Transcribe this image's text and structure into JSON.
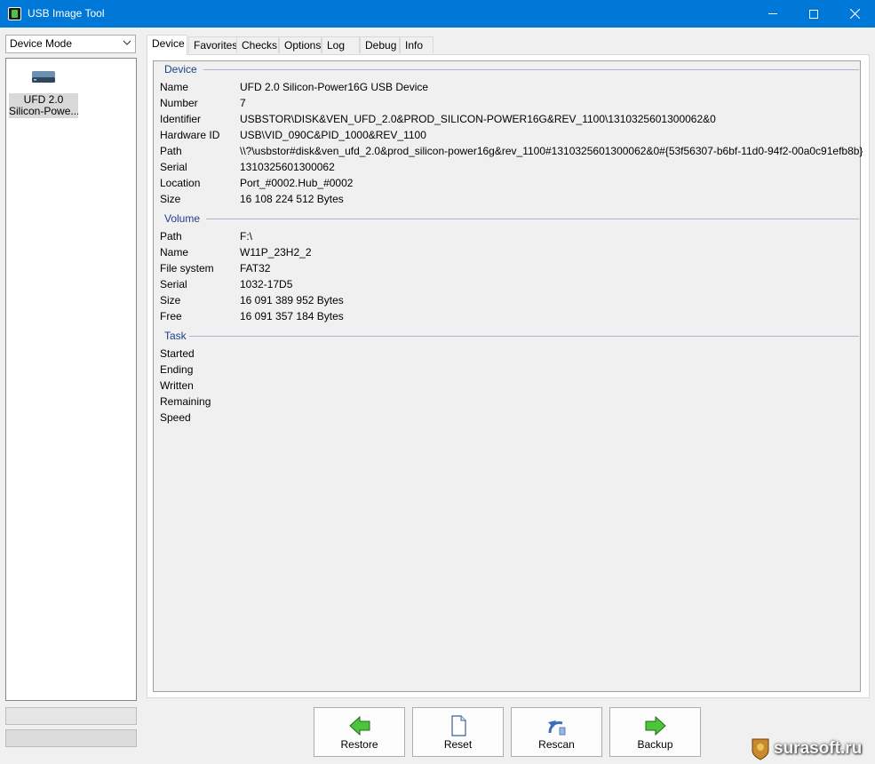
{
  "window": {
    "title": "USB Image Tool"
  },
  "colors": {
    "titlebar": "#0078d7",
    "section_header": "#1e3f8a"
  },
  "mode_select": {
    "value": "Device Mode"
  },
  "devices": [
    {
      "line1": "UFD 2.0",
      "line2": "Silicon-Powe..."
    }
  ],
  "tabs": [
    "Device",
    "Favorites",
    "Checks",
    "Options",
    "Log",
    "Debug",
    "Info"
  ],
  "sections": {
    "device": {
      "title": "Device",
      "rows": [
        {
          "label": "Name",
          "value": "UFD 2.0 Silicon-Power16G USB Device"
        },
        {
          "label": "Number",
          "value": "7"
        },
        {
          "label": "Identifier",
          "value": "USBSTOR\\DISK&VEN_UFD_2.0&PROD_SILICON-POWER16G&REV_1100\\1310325601300062&0"
        },
        {
          "label": "Hardware ID",
          "value": "USB\\VID_090C&PID_1000&REV_1100"
        },
        {
          "label": "Path",
          "value": "\\\\?\\usbstor#disk&ven_ufd_2.0&prod_silicon-power16g&rev_1100#1310325601300062&0#{53f56307-b6bf-11d0-94f2-00a0c91efb8b}"
        },
        {
          "label": "Serial",
          "value": "1310325601300062"
        },
        {
          "label": "Location",
          "value": "Port_#0002.Hub_#0002"
        },
        {
          "label": "Size",
          "value": "16 108 224 512 Bytes"
        }
      ]
    },
    "volume": {
      "title": "Volume",
      "rows": [
        {
          "label": "Path",
          "value": "F:\\"
        },
        {
          "label": "Name",
          "value": "W11P_23H2_2"
        },
        {
          "label": "File system",
          "value": "FAT32"
        },
        {
          "label": "Serial",
          "value": "1032-17D5"
        },
        {
          "label": "Size",
          "value": "16 091 389 952 Bytes"
        },
        {
          "label": "Free",
          "value": "16 091 357 184 Bytes"
        }
      ]
    },
    "task": {
      "title": "Task",
      "rows": [
        {
          "label": "Started",
          "value": ""
        },
        {
          "label": "Ending",
          "value": ""
        },
        {
          "label": "Written",
          "value": ""
        },
        {
          "label": "Remaining",
          "value": ""
        },
        {
          "label": "Speed",
          "value": ""
        }
      ]
    }
  },
  "buttons": {
    "restore": "Restore",
    "reset": "Reset",
    "rescan": "Rescan",
    "backup": "Backup"
  },
  "watermark": {
    "text": "surasoft.ru"
  }
}
